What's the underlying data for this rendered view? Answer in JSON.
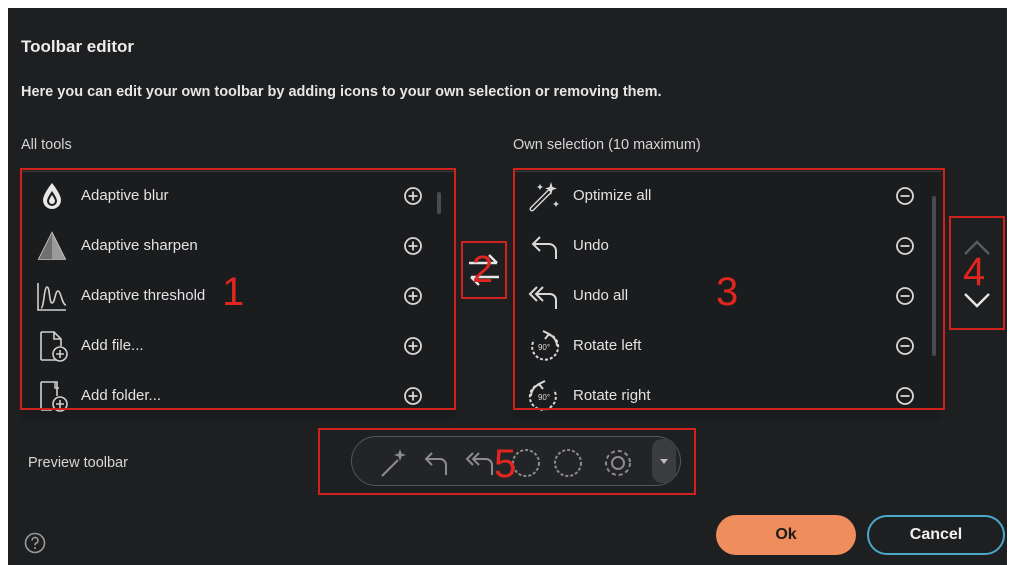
{
  "dialog": {
    "title": "Toolbar editor",
    "description": "Here you can edit your own toolbar by adding icons to your own selection or removing them."
  },
  "all_tools": {
    "label": "All tools",
    "items": [
      {
        "label": "Adaptive blur",
        "icon": "droplet-icon",
        "action": "plus-circle-icon"
      },
      {
        "label": "Adaptive sharpen",
        "icon": "triangle-icon",
        "action": "plus-circle-icon"
      },
      {
        "label": "Adaptive threshold",
        "icon": "threshold-curve-icon",
        "action": "plus-circle-icon"
      },
      {
        "label": "Add file...",
        "icon": "add-file-icon",
        "action": "plus-circle-icon"
      },
      {
        "label": "Add folder...",
        "icon": "add-folder-icon",
        "action": "plus-circle-icon"
      }
    ]
  },
  "own_selection": {
    "label": "Own selection (10 maximum)",
    "items": [
      {
        "label": "Optimize all",
        "icon": "magic-wand-icon",
        "action": "minus-circle-icon"
      },
      {
        "label": "Undo",
        "icon": "undo-arrow-icon",
        "action": "minus-circle-icon"
      },
      {
        "label": "Undo all",
        "icon": "undo-all-icon",
        "action": "minus-circle-icon"
      },
      {
        "label": "Rotate left",
        "icon": "rotate-left-icon",
        "action": "minus-circle-icon"
      },
      {
        "label": "Rotate right",
        "icon": "rotate-right-icon",
        "action": "minus-circle-icon"
      }
    ]
  },
  "annotations": [
    "1",
    "2",
    "3",
    "4",
    "5"
  ],
  "preview": {
    "label": "Preview toolbar",
    "icons": [
      "magic-wand-icon",
      "undo-arrow-icon",
      "undo-all-icon",
      "rotate-left-icon",
      "rotate-right-icon",
      "gear-icon"
    ]
  },
  "rotate_badge": "90°",
  "buttons": {
    "ok": "Ok",
    "cancel": "Cancel"
  },
  "colors": {
    "background": "#1e1f21",
    "accent_ok": "#ef8d5c",
    "cancel_border": "#4aa8c8",
    "annotation_red": "#d0221c"
  }
}
